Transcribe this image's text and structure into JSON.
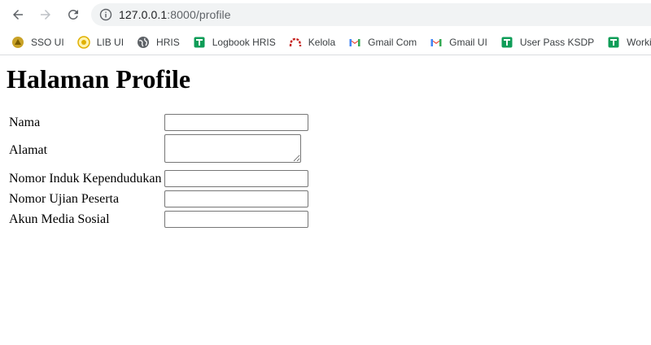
{
  "browser": {
    "url_host": "127.0.0.1",
    "url_path": ":8000/profile"
  },
  "bookmarks": [
    {
      "label": "SSO UI",
      "icon": "ui-crest-icon",
      "color": "#c9a227"
    },
    {
      "label": "LIB UI",
      "icon": "ui-lib-icon",
      "color": "#e0b000"
    },
    {
      "label": "HRIS",
      "icon": "globe-icon",
      "color": "#5f6368"
    },
    {
      "label": "Logbook HRIS",
      "icon": "sheets-icon",
      "color": "#0f9d58"
    },
    {
      "label": "Kelola",
      "icon": "kelola-arch-icon",
      "color": "#c5221f"
    },
    {
      "label": "Gmail Com",
      "icon": "gmail-icon",
      "color": "#ea4335"
    },
    {
      "label": "Gmail UI",
      "icon": "gmail-icon",
      "color": "#ea4335"
    },
    {
      "label": "User Pass KSDP",
      "icon": "sheets-icon",
      "color": "#0f9d58"
    },
    {
      "label": "Working F",
      "icon": "sheets-icon",
      "color": "#0f9d58"
    }
  ],
  "page": {
    "title": "Halaman Profile",
    "fields": [
      {
        "label": "Nama",
        "type": "text",
        "value": ""
      },
      {
        "label": "Alamat",
        "type": "textarea",
        "value": ""
      },
      {
        "label": "Nomor Induk Kependudukan",
        "type": "text",
        "value": ""
      },
      {
        "label": "Nomor Ujian Peserta",
        "type": "text",
        "value": ""
      },
      {
        "label": "Akun Media Sosial",
        "type": "text",
        "value": ""
      }
    ]
  }
}
